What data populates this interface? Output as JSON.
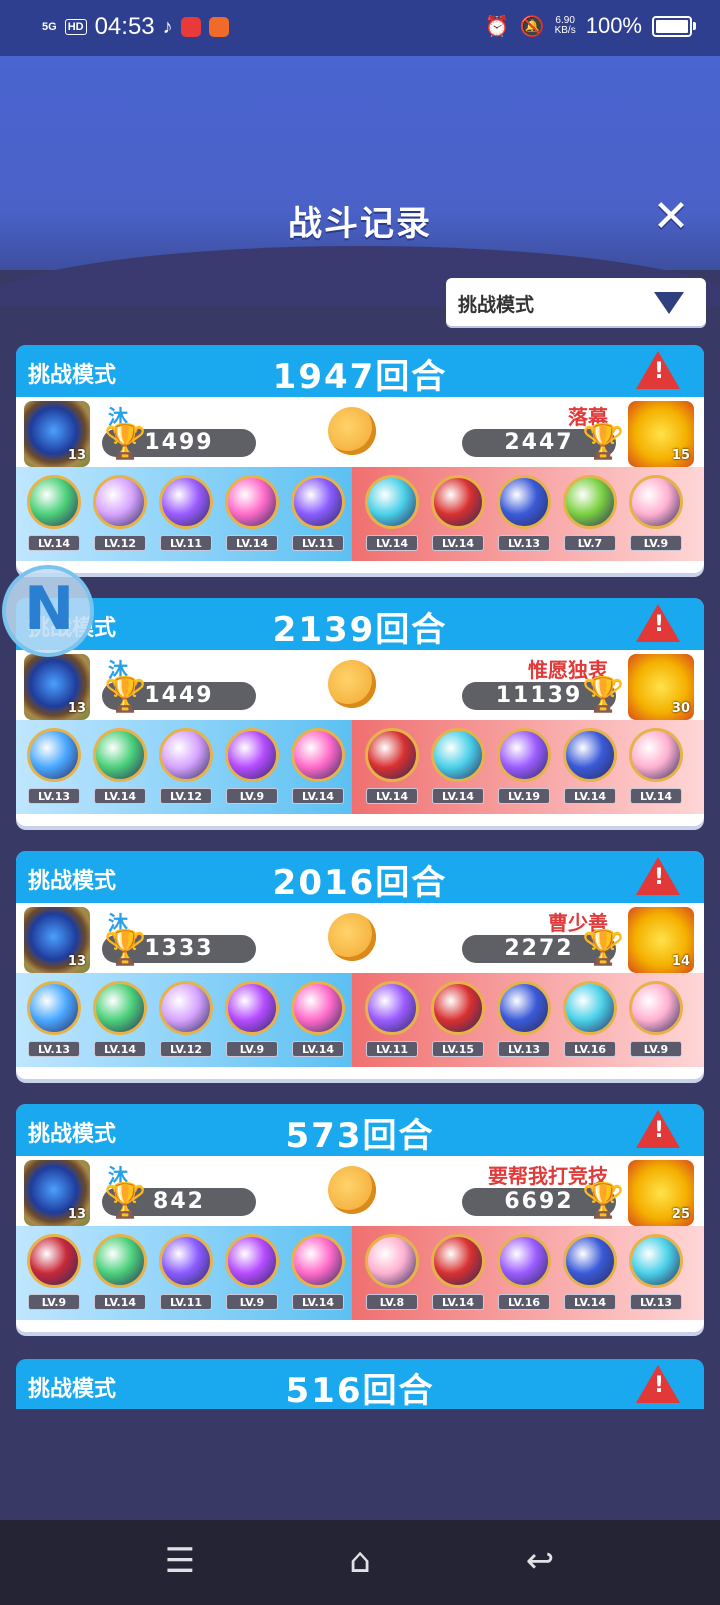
{
  "status_bar": {
    "network": "5G",
    "hd": "HD",
    "time": "04:53",
    "speed_value": "6.90",
    "speed_unit": "KB/s",
    "battery": "100%"
  },
  "header": {
    "title": "战斗记录",
    "close_icon": "close-icon"
  },
  "filter": {
    "selected": "挑战模式"
  },
  "battles": [
    {
      "mode": "挑战模式",
      "rounds": "1947回合",
      "left": {
        "name": "沐",
        "score": "1499",
        "avatar_level": "13"
      },
      "right": {
        "name": "落幕",
        "score": "2447",
        "avatar_level": "15"
      },
      "left_pets": [
        "LV.14",
        "LV.12",
        "LV.11",
        "LV.14",
        "LV.11"
      ],
      "right_pets": [
        "LV.14",
        "LV.14",
        "LV.13",
        "LV.7",
        "LV.9"
      ]
    },
    {
      "mode": "挑战模式",
      "rounds": "2139回合",
      "left": {
        "name": "沐",
        "score": "1449",
        "avatar_level": "13"
      },
      "right": {
        "name": "惟愿独衷",
        "score": "11139",
        "avatar_level": "30"
      },
      "left_pets": [
        "LV.13",
        "LV.14",
        "LV.12",
        "LV.9",
        "LV.14"
      ],
      "right_pets": [
        "LV.14",
        "LV.14",
        "LV.19",
        "LV.14",
        "LV.14"
      ]
    },
    {
      "mode": "挑战模式",
      "rounds": "2016回合",
      "left": {
        "name": "沐",
        "score": "1333",
        "avatar_level": "13"
      },
      "right": {
        "name": "曹少善",
        "score": "2272",
        "avatar_level": "14"
      },
      "left_pets": [
        "LV.13",
        "LV.14",
        "LV.12",
        "LV.9",
        "LV.14"
      ],
      "right_pets": [
        "LV.11",
        "LV.15",
        "LV.13",
        "LV.16",
        "LV.9"
      ]
    },
    {
      "mode": "挑战模式",
      "rounds": "573回合",
      "left": {
        "name": "沐",
        "score": "842",
        "avatar_level": "13"
      },
      "right": {
        "name": "要帮我打竞技",
        "score": "6692",
        "avatar_level": "25"
      },
      "left_pets": [
        "LV.9",
        "LV.14",
        "LV.11",
        "LV.9",
        "LV.14"
      ],
      "right_pets": [
        "LV.8",
        "LV.14",
        "LV.16",
        "LV.14",
        "LV.13"
      ]
    },
    {
      "mode": "挑战模式",
      "rounds": "516回合"
    }
  ],
  "colors": {
    "header_blue": "#4a64d0",
    "card_head": "#1aa9ee",
    "left_name": "#28a0e8",
    "right_name": "#e03a3a",
    "warning": "#e23838"
  }
}
